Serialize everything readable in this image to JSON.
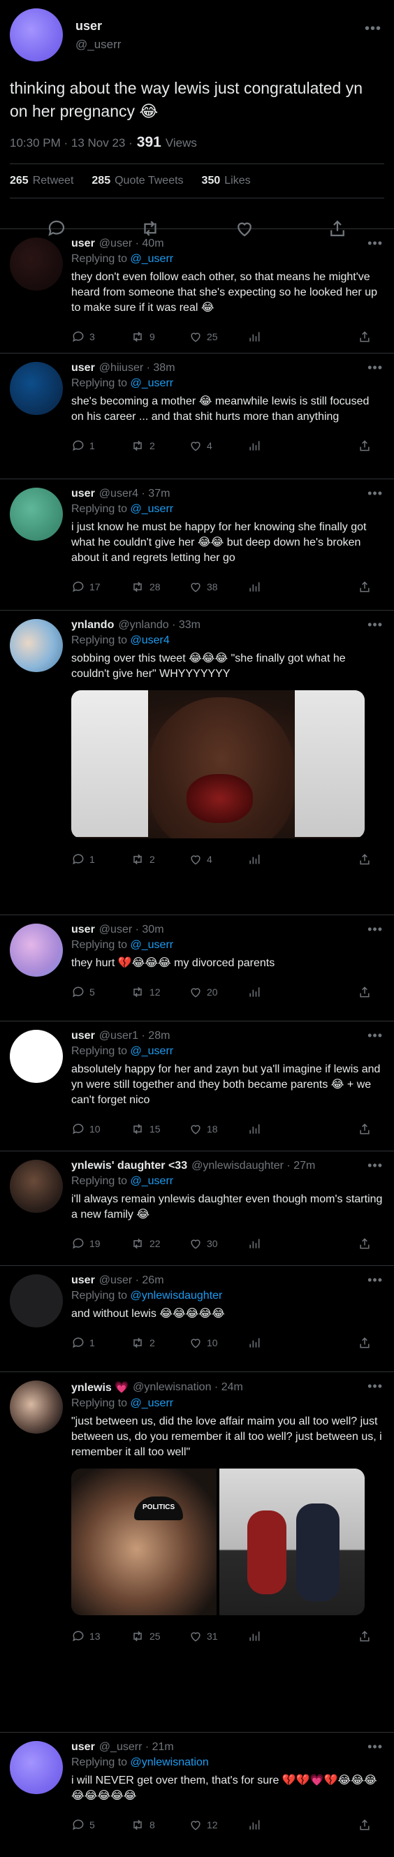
{
  "main": {
    "name": "user",
    "handle": "@_userr",
    "text": "thinking about the way lewis just congratulated yn on her pregnancy 😂",
    "time": "10:30 PM · 13 Nov 23 ·",
    "views_count": "391",
    "views_label": "Views",
    "stats": [
      {
        "count": "265",
        "label": "Retweet"
      },
      {
        "count": "285",
        "label": "Quote Tweets"
      },
      {
        "count": "350",
        "label": "Likes"
      }
    ],
    "avatar_color": "#8a7cf0"
  },
  "replies": [
    {
      "name": "user",
      "handle": "@user",
      "time": "· 40m",
      "replying_prefix": "Replying to",
      "replying_to": "@_userr",
      "text": "they don't even follow each other, so that means he might've heard from someone that she's expecting so he looked her up to make sure if it was real 😂",
      "replies": "3",
      "retweets": "9",
      "likes": "25"
    },
    {
      "name": "user",
      "handle": "@hiiuser",
      "time": "· 38m",
      "replying_prefix": "Replying to",
      "replying_to": "@_userr",
      "text": "she's becoming a mother 😂 meanwhile lewis is still focused on his career ... and that shit hurts more than anything",
      "replies": "1",
      "retweets": "2",
      "likes": "4"
    },
    {
      "name": "user",
      "handle": "@user4",
      "time": "· 37m",
      "replying_prefix": "Replying to",
      "replying_to": "@_userr",
      "text": "i just know he must be happy for her knowing she finally got what he couldn't give her 😂😂 but deep down he's broken about it and regrets letting her go",
      "replies": "17",
      "retweets": "28",
      "likes": "38"
    },
    {
      "name": "ynlando",
      "handle": "@ynlando",
      "time": "· 33m",
      "replying_prefix": "Replying to",
      "replying_to": "@user4",
      "text": "sobbing over this tweet 😂😂😂 \"she finally got what he couldn't give her\" WHYYYYYYY",
      "replies": "1",
      "retweets": "2",
      "likes": "4"
    },
    {
      "name": "user",
      "handle": "@user",
      "time": "· 30m",
      "replying_prefix": "Replying to",
      "replying_to": "@_userr",
      "text": "they hurt 💔😂😂😂 my divorced parents",
      "replies": "5",
      "retweets": "12",
      "likes": "20"
    },
    {
      "name": "user",
      "handle": "@user1",
      "time": "· 28m",
      "replying_prefix": "Replying to",
      "replying_to": "@_userr",
      "text": "absolutely happy for her and zayn but ya'll imagine if lewis and yn were still together and they both became parents 😂 + we can't forget nico",
      "replies": "10",
      "retweets": "15",
      "likes": "18"
    },
    {
      "name": "ynlewis' daughter <33",
      "handle": "@ynlewisdaughter",
      "time": "· 27m",
      "replying_prefix": "Replying to",
      "replying_to": "@_userr",
      "text": "i'll always remain ynlewis daughter even though mom's starting a new family 😂",
      "replies": "19",
      "retweets": "22",
      "likes": "30"
    },
    {
      "name": "user",
      "handle": "@user",
      "time": "· 26m",
      "replying_prefix": "Replying to",
      "replying_to": "@ynlewisdaughter",
      "text": "and without lewis 😂😂😂😂😂",
      "replies": "1",
      "retweets": "2",
      "likes": "10"
    },
    {
      "name": "ynlewis 💗",
      "handle": "@ynlewisnation",
      "time": "· 24m",
      "replying_prefix": "Replying to",
      "replying_to": "@_userr",
      "text": "\"just between us, did the love affair maim you all too well? just between us, do you remember it all too well? just between us, i remember it all too well\"",
      "media_caption": "POLITICS",
      "replies": "13",
      "retweets": "25",
      "likes": "31"
    },
    {
      "name": "user",
      "handle": "@_userr",
      "time": "· 21m",
      "replying_prefix": "Replying to",
      "replying_to": "@ynlewisnation",
      "text": "i will NEVER get over them, that's for sure 💔💔💗💔😂😂😂😂😂😂😂😂",
      "replies": "5",
      "retweets": "8",
      "likes": "12"
    }
  ],
  "colors": {
    "background": "#000000",
    "text": "#e7e9ea",
    "muted": "#71767b",
    "link": "#1d9bf0",
    "divider": "#2f3336"
  }
}
